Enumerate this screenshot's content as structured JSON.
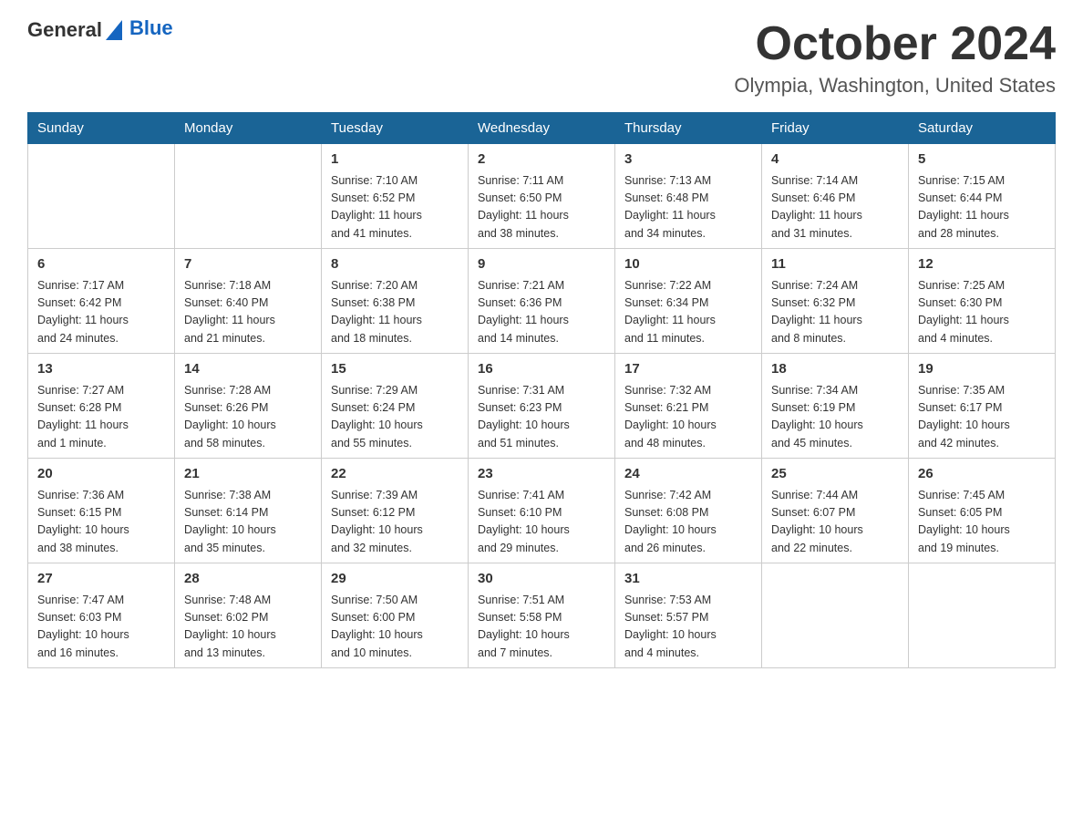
{
  "header": {
    "logo_general": "General",
    "logo_blue": "Blue",
    "month_year": "October 2024",
    "location": "Olympia, Washington, United States"
  },
  "days_of_week": [
    "Sunday",
    "Monday",
    "Tuesday",
    "Wednesday",
    "Thursday",
    "Friday",
    "Saturday"
  ],
  "weeks": [
    [
      {
        "day": "",
        "info": ""
      },
      {
        "day": "",
        "info": ""
      },
      {
        "day": "1",
        "info": "Sunrise: 7:10 AM\nSunset: 6:52 PM\nDaylight: 11 hours\nand 41 minutes."
      },
      {
        "day": "2",
        "info": "Sunrise: 7:11 AM\nSunset: 6:50 PM\nDaylight: 11 hours\nand 38 minutes."
      },
      {
        "day": "3",
        "info": "Sunrise: 7:13 AM\nSunset: 6:48 PM\nDaylight: 11 hours\nand 34 minutes."
      },
      {
        "day": "4",
        "info": "Sunrise: 7:14 AM\nSunset: 6:46 PM\nDaylight: 11 hours\nand 31 minutes."
      },
      {
        "day": "5",
        "info": "Sunrise: 7:15 AM\nSunset: 6:44 PM\nDaylight: 11 hours\nand 28 minutes."
      }
    ],
    [
      {
        "day": "6",
        "info": "Sunrise: 7:17 AM\nSunset: 6:42 PM\nDaylight: 11 hours\nand 24 minutes."
      },
      {
        "day": "7",
        "info": "Sunrise: 7:18 AM\nSunset: 6:40 PM\nDaylight: 11 hours\nand 21 minutes."
      },
      {
        "day": "8",
        "info": "Sunrise: 7:20 AM\nSunset: 6:38 PM\nDaylight: 11 hours\nand 18 minutes."
      },
      {
        "day": "9",
        "info": "Sunrise: 7:21 AM\nSunset: 6:36 PM\nDaylight: 11 hours\nand 14 minutes."
      },
      {
        "day": "10",
        "info": "Sunrise: 7:22 AM\nSunset: 6:34 PM\nDaylight: 11 hours\nand 11 minutes."
      },
      {
        "day": "11",
        "info": "Sunrise: 7:24 AM\nSunset: 6:32 PM\nDaylight: 11 hours\nand 8 minutes."
      },
      {
        "day": "12",
        "info": "Sunrise: 7:25 AM\nSunset: 6:30 PM\nDaylight: 11 hours\nand 4 minutes."
      }
    ],
    [
      {
        "day": "13",
        "info": "Sunrise: 7:27 AM\nSunset: 6:28 PM\nDaylight: 11 hours\nand 1 minute."
      },
      {
        "day": "14",
        "info": "Sunrise: 7:28 AM\nSunset: 6:26 PM\nDaylight: 10 hours\nand 58 minutes."
      },
      {
        "day": "15",
        "info": "Sunrise: 7:29 AM\nSunset: 6:24 PM\nDaylight: 10 hours\nand 55 minutes."
      },
      {
        "day": "16",
        "info": "Sunrise: 7:31 AM\nSunset: 6:23 PM\nDaylight: 10 hours\nand 51 minutes."
      },
      {
        "day": "17",
        "info": "Sunrise: 7:32 AM\nSunset: 6:21 PM\nDaylight: 10 hours\nand 48 minutes."
      },
      {
        "day": "18",
        "info": "Sunrise: 7:34 AM\nSunset: 6:19 PM\nDaylight: 10 hours\nand 45 minutes."
      },
      {
        "day": "19",
        "info": "Sunrise: 7:35 AM\nSunset: 6:17 PM\nDaylight: 10 hours\nand 42 minutes."
      }
    ],
    [
      {
        "day": "20",
        "info": "Sunrise: 7:36 AM\nSunset: 6:15 PM\nDaylight: 10 hours\nand 38 minutes."
      },
      {
        "day": "21",
        "info": "Sunrise: 7:38 AM\nSunset: 6:14 PM\nDaylight: 10 hours\nand 35 minutes."
      },
      {
        "day": "22",
        "info": "Sunrise: 7:39 AM\nSunset: 6:12 PM\nDaylight: 10 hours\nand 32 minutes."
      },
      {
        "day": "23",
        "info": "Sunrise: 7:41 AM\nSunset: 6:10 PM\nDaylight: 10 hours\nand 29 minutes."
      },
      {
        "day": "24",
        "info": "Sunrise: 7:42 AM\nSunset: 6:08 PM\nDaylight: 10 hours\nand 26 minutes."
      },
      {
        "day": "25",
        "info": "Sunrise: 7:44 AM\nSunset: 6:07 PM\nDaylight: 10 hours\nand 22 minutes."
      },
      {
        "day": "26",
        "info": "Sunrise: 7:45 AM\nSunset: 6:05 PM\nDaylight: 10 hours\nand 19 minutes."
      }
    ],
    [
      {
        "day": "27",
        "info": "Sunrise: 7:47 AM\nSunset: 6:03 PM\nDaylight: 10 hours\nand 16 minutes."
      },
      {
        "day": "28",
        "info": "Sunrise: 7:48 AM\nSunset: 6:02 PM\nDaylight: 10 hours\nand 13 minutes."
      },
      {
        "day": "29",
        "info": "Sunrise: 7:50 AM\nSunset: 6:00 PM\nDaylight: 10 hours\nand 10 minutes."
      },
      {
        "day": "30",
        "info": "Sunrise: 7:51 AM\nSunset: 5:58 PM\nDaylight: 10 hours\nand 7 minutes."
      },
      {
        "day": "31",
        "info": "Sunrise: 7:53 AM\nSunset: 5:57 PM\nDaylight: 10 hours\nand 4 minutes."
      },
      {
        "day": "",
        "info": ""
      },
      {
        "day": "",
        "info": ""
      }
    ]
  ]
}
